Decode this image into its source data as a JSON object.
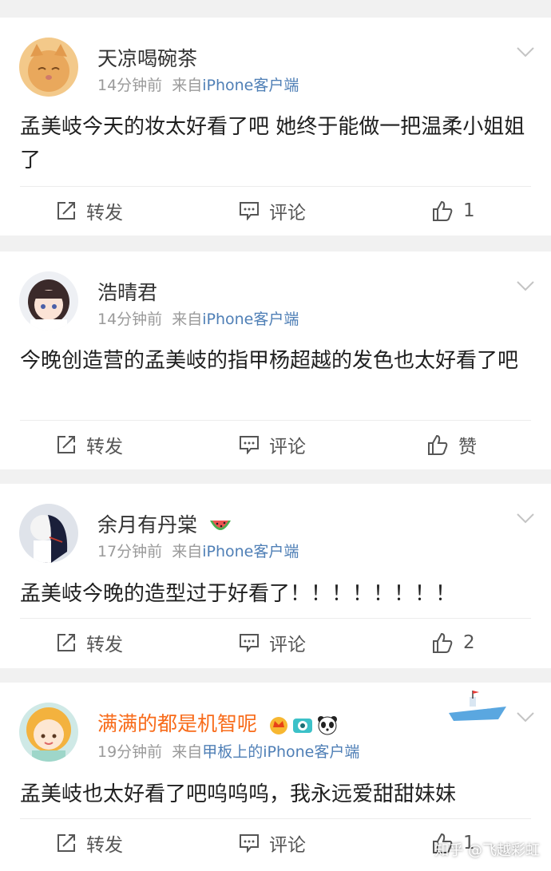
{
  "actions": {
    "repost": "转发",
    "comment": "评论",
    "like_placeholder": "赞"
  },
  "posts": [
    {
      "username": "天凉喝碗茶",
      "time": "14分钟前",
      "from_prefix": "来自",
      "source": "iPhone客户端",
      "text": "孟美岐今天的妆太好看了吧 她终于能做一把温柔小姐姐了",
      "like_count": "1"
    },
    {
      "username": "浩晴君",
      "time": "14分钟前",
      "from_prefix": "来自",
      "source": "iPhone客户端",
      "text": "今晚创造营的孟美岐的指甲杨超越的发色也太好看了吧",
      "like_count": "赞"
    },
    {
      "username": "余月有丹棠",
      "time": "17分钟前",
      "from_prefix": "来自",
      "source": "iPhone客户端",
      "text": "孟美岐今晚的造型过于好看了！！！！！！！！",
      "like_count": "2",
      "name_badges": [
        "watermelon-icon"
      ]
    },
    {
      "username": "满满的都是机智呢",
      "time": "19分钟前",
      "from_prefix": "来自",
      "source": "甲板上的iPhone客户端",
      "text": "孟美岐也太好看了吧呜呜呜，我永远爱甜甜妹妹",
      "like_count": "1",
      "name_badges": [
        "crown-vip-icon",
        "camera-icon",
        "panda-icon"
      ]
    }
  ],
  "watermark": "知乎 @飞越彩虹",
  "colors": {
    "vip_name": "#f86b1a",
    "source_link": "#4f7fb6",
    "meta": "#9a9a9a",
    "text": "#1f1f1f",
    "background": "#f1f1f1"
  }
}
